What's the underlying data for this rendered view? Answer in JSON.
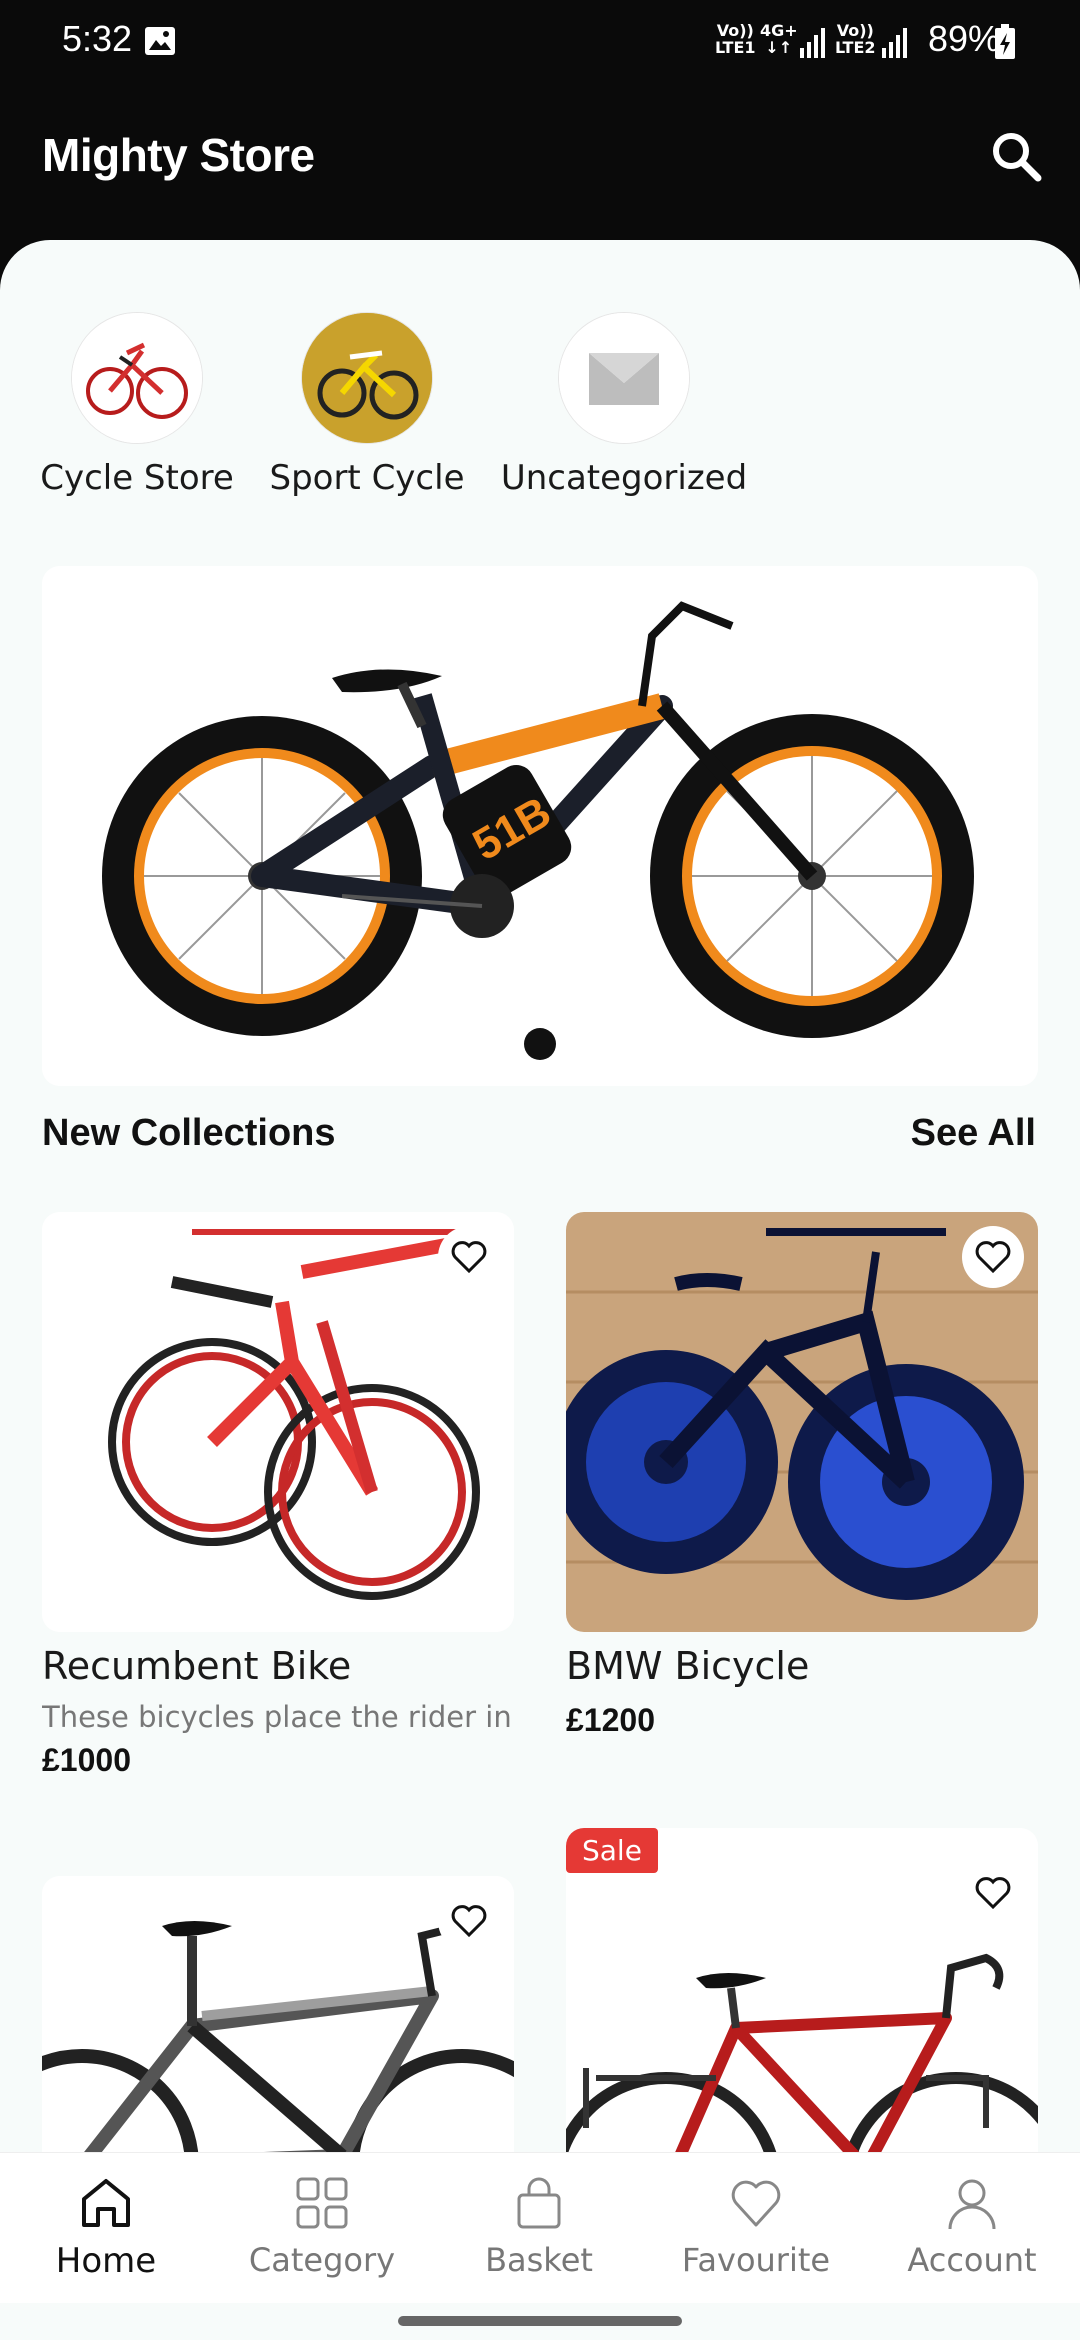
{
  "status_bar": {
    "time": "5:32",
    "net_lte1_top": "Vo))",
    "net_lte1_bottom": "LTE1",
    "net_4g": "4G+",
    "net_lte2_top": "Vo))",
    "net_lte2_bottom": "LTE2",
    "battery": "89%"
  },
  "app_bar": {
    "title": "Mighty Store",
    "search_icon": "search-icon"
  },
  "categories": [
    {
      "label": "Cycle Store"
    },
    {
      "label": "Sport Cycle"
    },
    {
      "label": "Uncategorized"
    }
  ],
  "banner": {
    "slide_count": 1,
    "active_slide": 1
  },
  "collections": {
    "title": "New Collections",
    "see_all": "See All",
    "products": [
      {
        "name": "Recumbent Bike",
        "description": "These bicycles place the rider in",
        "price": "£1000"
      },
      {
        "name": "BMW Bicycle",
        "description": "",
        "price": "£1200"
      },
      {
        "name": "",
        "description": "",
        "price": ""
      },
      {
        "name": "",
        "description": "",
        "price": "",
        "badge": "Sale"
      }
    ]
  },
  "bottom_nav": {
    "items": [
      {
        "label": "Home",
        "icon": "home-icon",
        "active": true
      },
      {
        "label": "Category",
        "icon": "grid-icon"
      },
      {
        "label": "Basket",
        "icon": "bag-icon"
      },
      {
        "label": "Favourite",
        "icon": "heart-icon"
      },
      {
        "label": "Account",
        "icon": "user-icon"
      }
    ]
  },
  "colors": {
    "app_bar": "#0a0a0a",
    "sheet": "#f7fbfa",
    "sale": "#e53935",
    "accent_orange": "#f08a1c"
  }
}
